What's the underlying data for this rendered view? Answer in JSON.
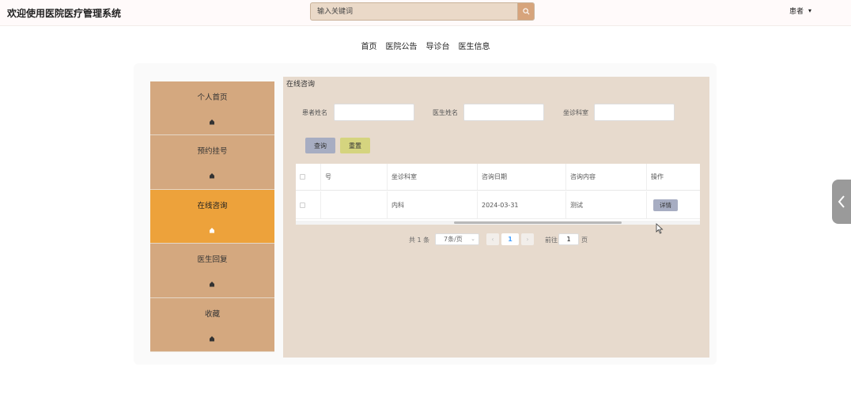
{
  "header": {
    "title": "欢迎使用医院医疗管理系统",
    "search_placeholder": "输入关键词",
    "user_label": "患者",
    "user_caret": "▾"
  },
  "nav": {
    "items": [
      "首页",
      "医院公告",
      "导诊台",
      "医生信息"
    ]
  },
  "sidebar": {
    "items": [
      {
        "label": "个人首页"
      },
      {
        "label": "预约挂号"
      },
      {
        "label": "在线咨询",
        "active": true
      },
      {
        "label": "医生回复"
      },
      {
        "label": "收藏"
      }
    ]
  },
  "main": {
    "title": "在线咨询",
    "filters": {
      "patient_name_label": "患者姓名",
      "doctor_name_label": "医生姓名",
      "department_label": "坐诊科室"
    },
    "buttons": {
      "query": "查询",
      "reset": "重置"
    },
    "table": {
      "headers": [
        "号",
        "坐诊科室",
        "咨询日期",
        "咨询内容",
        "操作"
      ],
      "rows": [
        {
          "col0": "",
          "department": "内科",
          "date": "2024-03-31",
          "content": "测试",
          "action": "详情"
        }
      ]
    },
    "pagination": {
      "total": "共 1 条",
      "page_size": "7条/页",
      "current_page": "1",
      "goto_label": "前往",
      "goto_value": "1",
      "page_suffix": "页",
      "prev": "‹",
      "next": "›",
      "caret": "⌄"
    }
  },
  "colors": {
    "accent_active": "#eda23b",
    "sidebar_bg": "#d4a87f",
    "content_bg": "#e7dacd",
    "query_button": "#a7adc2",
    "reset_button": "#d5d47f"
  }
}
